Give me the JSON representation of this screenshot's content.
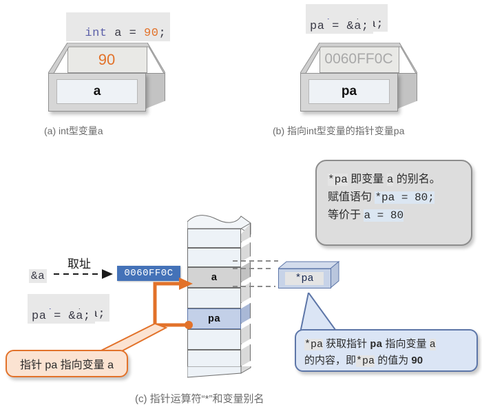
{
  "figure": {
    "caption_c": "(c) 指针运算符“*”和变量别名"
  },
  "panel_a": {
    "caption": "(a) int型变量a",
    "code": {
      "kw": "int",
      "rest": " a = ",
      "value": "90",
      "semi": ";",
      "full": "int a = 90;"
    },
    "box": {
      "top_value": "90",
      "label": "a"
    }
  },
  "panel_b": {
    "caption": "(b) 指向int型变量的指针变量pa",
    "code_line1": {
      "kw": "int",
      "rest": " *pa;",
      "full": "int *pa;"
    },
    "code_line2": {
      "full": "pa = &a;"
    },
    "box": {
      "top_value": "0060FF0C",
      "label": "pa"
    }
  },
  "panel_c": {
    "address_label": "&a",
    "arrow_label": "取址",
    "address_value": "0060FF0C",
    "code_line1": {
      "kw": "int",
      "rest": " *pa;",
      "full": "int *pa;"
    },
    "code_line2": {
      "full": "pa = &a;"
    },
    "memory": {
      "cells": [
        {
          "label": "",
          "style": "plain"
        },
        {
          "label": "",
          "style": "plain"
        },
        {
          "label": "a",
          "style": "gray"
        },
        {
          "label": "",
          "style": "plain"
        },
        {
          "label": "pa",
          "style": "blue"
        },
        {
          "label": "",
          "style": "plain"
        },
        {
          "label": "",
          "style": "plain"
        }
      ]
    },
    "deref_box": {
      "label": "*pa"
    },
    "note_gray": {
      "line1_a": "*pa",
      "line1_b": " 即变量 ",
      "line1_c": "a",
      "line1_d": " 的别名。",
      "line2_a": "赋值语句 ",
      "line2_b": "*pa = 80;",
      "line3_a": "等价于 ",
      "line3_b": "a = 80"
    },
    "note_blue": {
      "line1_a": "*pa",
      "line1_b": " 获取指针 ",
      "line1_c": "pa",
      "line1_d": " 指向变量 ",
      "line1_e": "a",
      "line2_a": "的内容，即",
      "line2_b": "*pa",
      "line2_c": " 的值为 ",
      "line2_d": "90"
    },
    "note_orange": {
      "text": "指针 pa 指向变量 a"
    }
  },
  "colors": {
    "accent_orange": "#e2722a",
    "accent_blue": "#4472b8",
    "keyword": "#5b5fa8",
    "cell_highlight_blue": "#c3d0e8",
    "cell_highlight_gray": "#d3d3d3"
  }
}
